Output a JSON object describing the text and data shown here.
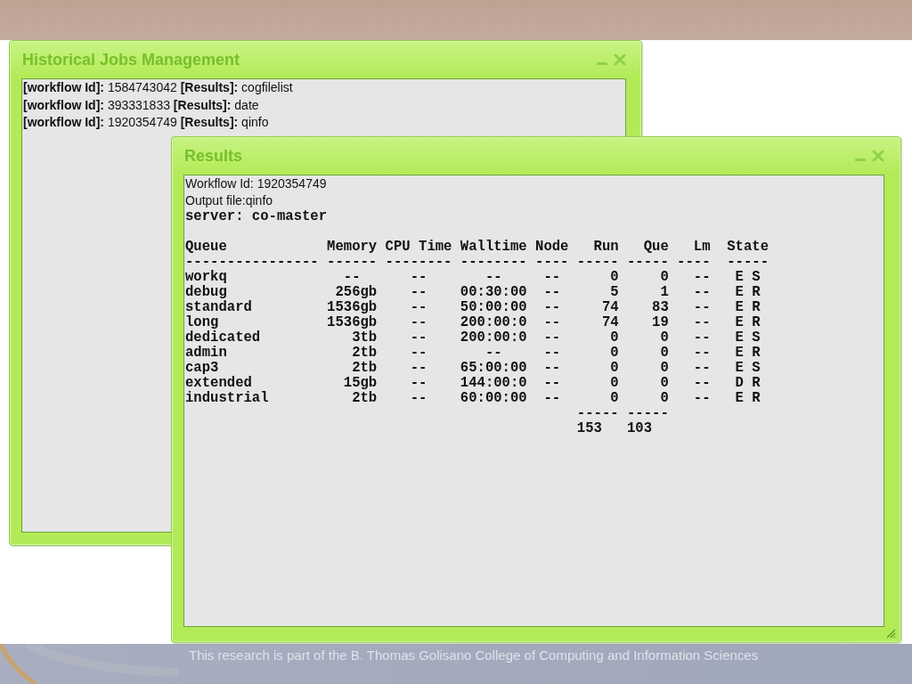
{
  "windows": [
    {
      "kind": "job_list",
      "title": "Historical Jobs Management",
      "jobs": [
        "**[workflow Id]:** 1584743042 **[Results]:** cogfilelist",
        "**[workflow Id]:** 393331833 **[Results]:** date",
        "**[workflow Id]:** 1920354749 **[Results]:** qinfo"
      ]
    },
    {
      "kind": "output",
      "title": "Results",
      "resizable": true,
      "details": [
        "Workflow Id: 1920354749",
        "Output file:qinfo"
      ],
      "server": "server: co-master",
      "table_lines": [
        "Queue            Memory CPU Time Walltime Node   Run   Que   Lm  State",
        "---------------- ------ -------- -------- ---- ----- ----- ----  -----",
        "workq              --      --       --     --      0     0   --   E S",
        "debug             256gb    --    00:30:00  --      5     1   --   E R",
        "standard         1536gb    --    50:00:00  --     74    83   --   E R",
        "long             1536gb    --    200:00:0  --     74    19   --   E R",
        "dedicated           3tb    --    200:00:0  --      0     0   --   E S",
        "admin               2tb    --       --     --      0     0   --   E R",
        "cap3                2tb    --    65:00:00  --      0     0   --   E S",
        "extended           15gb    --    144:00:0  --      0     0   --   D R",
        "industrial          2tb    --    60:00:00  --      0     0   --   E R"
      ],
      "totals_rule": "----- -----",
      "totals": "153   103"
    }
  ],
  "footer": "This research is part of the B. Thomas Golisano College of Computing and Information Sciences"
}
